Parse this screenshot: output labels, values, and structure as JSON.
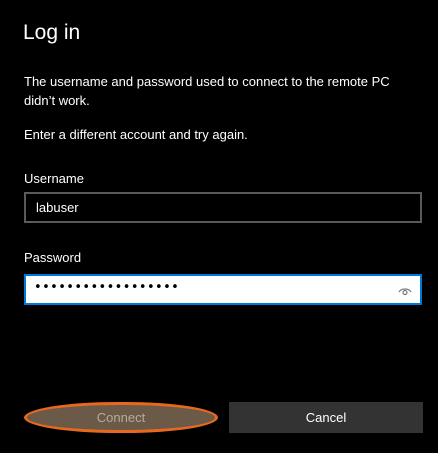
{
  "dialog": {
    "title": "Log in",
    "message": "The username and password used to connect to the remote PC didn’t work.",
    "hint": "Enter a different account and try again."
  },
  "username": {
    "label": "Username",
    "value": "labuser"
  },
  "password": {
    "label": "Password",
    "masked_value": "••••••••••••••••••",
    "reveal_icon": "eye-icon"
  },
  "buttons": {
    "connect_label": "Connect",
    "cancel_label": "Cancel"
  },
  "colors": {
    "background": "#000000",
    "focus_border": "#0078d7",
    "highlight_ring": "#e8691e",
    "connect_disabled_bg": "#6b5a48",
    "cancel_bg": "#333333"
  }
}
